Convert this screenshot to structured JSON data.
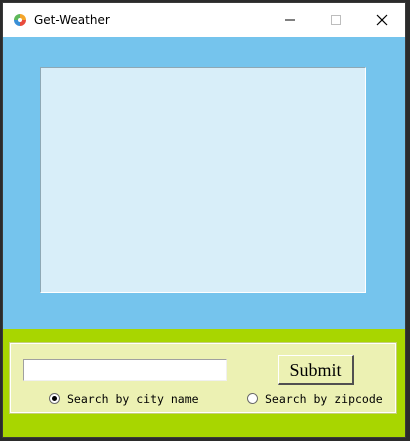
{
  "window": {
    "title": "Get-Weather",
    "controls": {
      "minimize": "—",
      "maximize": "☐",
      "close": "✕"
    }
  },
  "form": {
    "city_value": "",
    "submit_label": "Submit",
    "search_modes": [
      {
        "label": "Search by city name",
        "selected": true
      },
      {
        "label": "Search by zipcode",
        "selected": false
      }
    ]
  },
  "colors": {
    "sky": "#75c4ed",
    "panel": "#d8eef9",
    "grass": "#a8d600",
    "controls_bg": "#ecf1b3"
  },
  "icons": {
    "app": "weather-app-icon",
    "minimize": "minimize-icon",
    "maximize": "maximize-icon",
    "close": "close-icon"
  }
}
